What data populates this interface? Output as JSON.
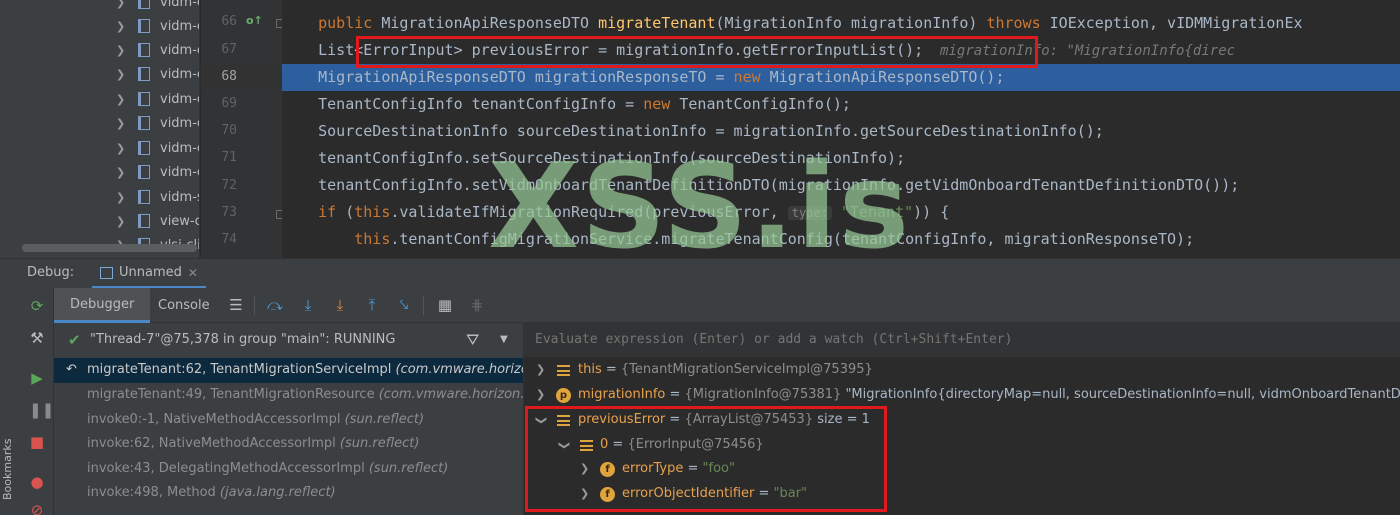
{
  "project_tree": {
    "items": [
      {
        "label": "vidm-c"
      },
      {
        "label": "vidm-c"
      },
      {
        "label": "vidm-c"
      },
      {
        "label": "vidm-c"
      },
      {
        "label": "vidm-c"
      },
      {
        "label": "vidm-c"
      },
      {
        "label": "vidm-c"
      },
      {
        "label": "vidm-c"
      },
      {
        "label": "vidm-s"
      },
      {
        "label": "view-c"
      },
      {
        "label": "vlsi-cli"
      }
    ]
  },
  "editor": {
    "line_numbers": [
      "66",
      "67",
      "68",
      "69",
      "70",
      "71",
      "72",
      "73",
      "74"
    ],
    "lines": {
      "l66": {
        "kw_public": "public ",
        "type": "MigrationApiResponseDTO ",
        "method": "migrateTenant",
        "params": "(MigrationInfo migrationInfo) ",
        "kw_throws": "throws ",
        "exceptions": "IOException, vIDMMigrationEx"
      },
      "l67": {
        "code": "    List<ErrorInput> previousError = migrationInfo.getErrorInputList();",
        "inline_value": "  migrationInfo: \"MigrationInfo{direc"
      },
      "l68": {
        "a": "    MigrationApiResponseDTO migrationResponseTO = ",
        "kw_new": "new ",
        "b": "MigrationApiResponseDTO();"
      },
      "l69": {
        "a": "    TenantConfigInfo tenantConfigInfo = ",
        "kw_new": "new ",
        "b": "TenantConfigInfo();"
      },
      "l70": {
        "code": "    SourceDestinationInfo sourceDestinationInfo = migrationInfo.getSourceDestinationInfo();"
      },
      "l71": {
        "code": "    tenantConfigInfo.setSourceDestinationInfo(sourceDestinationInfo);"
      },
      "l72": {
        "code": "    tenantConfigInfo.setVidmOnboardTenantDefinitionDTO(migrationInfo.getVidmOnboardTenantDefinitionDTO());"
      },
      "l73": {
        "kw_if": "    if ",
        "a": "(",
        "kw_this": "this",
        "b": ".validateIfMigrationRequired(previousError, ",
        "hint": "type:",
        "str": " \"Tenant\"",
        "c": ")) {"
      },
      "l74": {
        "kw_this": "        this",
        "code": ".tenantConfigMigrationService.migrateTenantConfig(tenantConfigInfo, migrationResponseTO);"
      }
    },
    "watermark": "XSS.is"
  },
  "debug": {
    "title": "Debug:",
    "session_tab": "Unnamed",
    "tabs": {
      "debugger": "Debugger",
      "console": "Console"
    },
    "side_label": "Bookmarks",
    "thread": "\"Thread-7\"@75,378 in group \"main\": RUNNING",
    "frames": [
      {
        "method": "migrateTenant:62, TenantMigrationServiceImpl ",
        "pkg": "(com.vmware.horizo"
      },
      {
        "method": "migrateTenant:49, TenantMigrationResource ",
        "pkg": "(com.vmware.horizon.n"
      },
      {
        "method": "invoke0:-1, NativeMethodAccessorImpl ",
        "pkg": "(sun.reflect)"
      },
      {
        "method": "invoke:62, NativeMethodAccessorImpl ",
        "pkg": "(sun.reflect)"
      },
      {
        "method": "invoke:43, DelegatingMethodAccessorImpl ",
        "pkg": "(sun.reflect)"
      },
      {
        "method": "invoke:498, Method ",
        "pkg": "(java.lang.reflect)"
      }
    ],
    "eval_placeholder": "Evaluate expression (Enter) or add a watch (Ctrl+Shift+Enter)",
    "variables": {
      "this": {
        "name": "this",
        "sep": " = ",
        "type": "{TenantMigrationServiceImpl@75395}"
      },
      "migrationInfo": {
        "badge": "p",
        "name": "migrationInfo",
        "sep": " = ",
        "type": "{MigrationInfo@75381} ",
        "value": "\"MigrationInfo{directoryMap=null, sourceDestinationInfo=null, vidmOnboardTenantDe"
      },
      "previousError": {
        "name": "previousError",
        "sep": " = ",
        "type": "{ArrayList@75453} ",
        "size": " size = 1"
      },
      "item0": {
        "name": "0",
        "sep": " = ",
        "type": "{ErrorInput@75456}"
      },
      "errorType": {
        "badge": "f",
        "name": "errorType",
        "sep": " = ",
        "value": "\"foo\""
      },
      "errorObjectIdentifier": {
        "badge": "f",
        "name": "errorObjectIdentifier",
        "sep": " = ",
        "value": "\"bar\""
      }
    }
  },
  "colors": {
    "accent_red": "#e0191c",
    "selection_blue": "#2d5f9e",
    "keyword": "#cc7832",
    "method": "#ffc66d",
    "string": "#6a8759",
    "var_name": "#e8a14e",
    "watermark": "#96c896"
  },
  "icons": [
    "chevron-right-icon",
    "library-icon",
    "override-gutter-icon",
    "fold-icon",
    "session-icon",
    "close-icon",
    "rerun-icon",
    "settings-wrench-icon",
    "resume-icon",
    "pause-icon",
    "stop-icon",
    "view-breakpoints-icon",
    "mute-breakpoints-icon",
    "frames-list-icon",
    "step-over-icon",
    "step-into-icon",
    "force-step-into-icon",
    "step-out-icon",
    "run-to-cursor-icon",
    "evaluate-expression-icon",
    "trace-icon",
    "checkmark-icon",
    "filter-icon",
    "dropdown-icon",
    "return-arrow-icon",
    "list-variable-icon",
    "field-icon",
    "parameter-icon"
  ]
}
